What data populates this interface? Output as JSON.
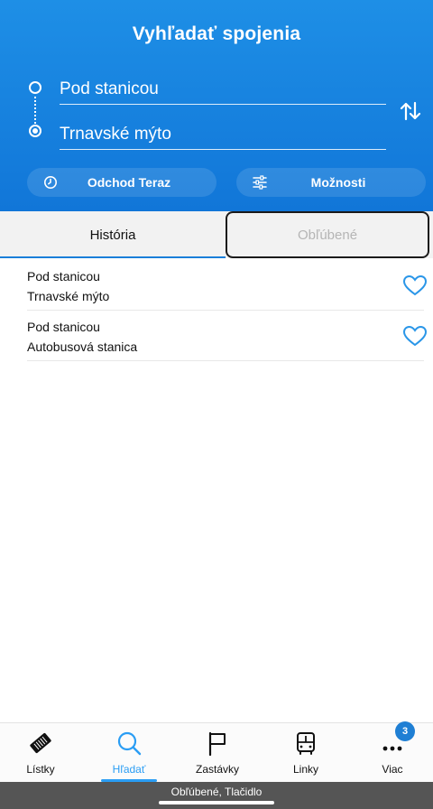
{
  "header": {
    "title": "Vyhľadať spojenia",
    "from": "Pod stanicou",
    "to": "Trnavské mýto",
    "swap_icon": "swap-arrows-icon",
    "depart_label": "Odchod Teraz",
    "depart_icon": "clock-icon",
    "options_label": "Možnosti",
    "options_icon": "sliders-icon",
    "accent_color": "#1a85e0"
  },
  "tabs": [
    {
      "label": "História",
      "active": true
    },
    {
      "label": "Obľúbené",
      "active": false
    }
  ],
  "history": [
    {
      "from": "Pod stanicou",
      "to": "Trnavské mýto",
      "icon": "heart-outline-icon"
    },
    {
      "from": "Pod stanicou",
      "to": "Autobusová stanica",
      "icon": "heart-outline-icon"
    }
  ],
  "tabbar": {
    "items": [
      {
        "label": "Lístky",
        "icon": "ticket-icon"
      },
      {
        "label": "Hľadať",
        "icon": "search-icon",
        "active": true
      },
      {
        "label": "Zastávky",
        "icon": "flag-icon"
      },
      {
        "label": "Linky",
        "icon": "bus-icon"
      },
      {
        "label": "Viac",
        "icon": "more-icon",
        "badge": "3"
      }
    ],
    "active_color": "#2a9df4"
  },
  "status": {
    "text": "Obľúbené, Tlačidlo"
  }
}
